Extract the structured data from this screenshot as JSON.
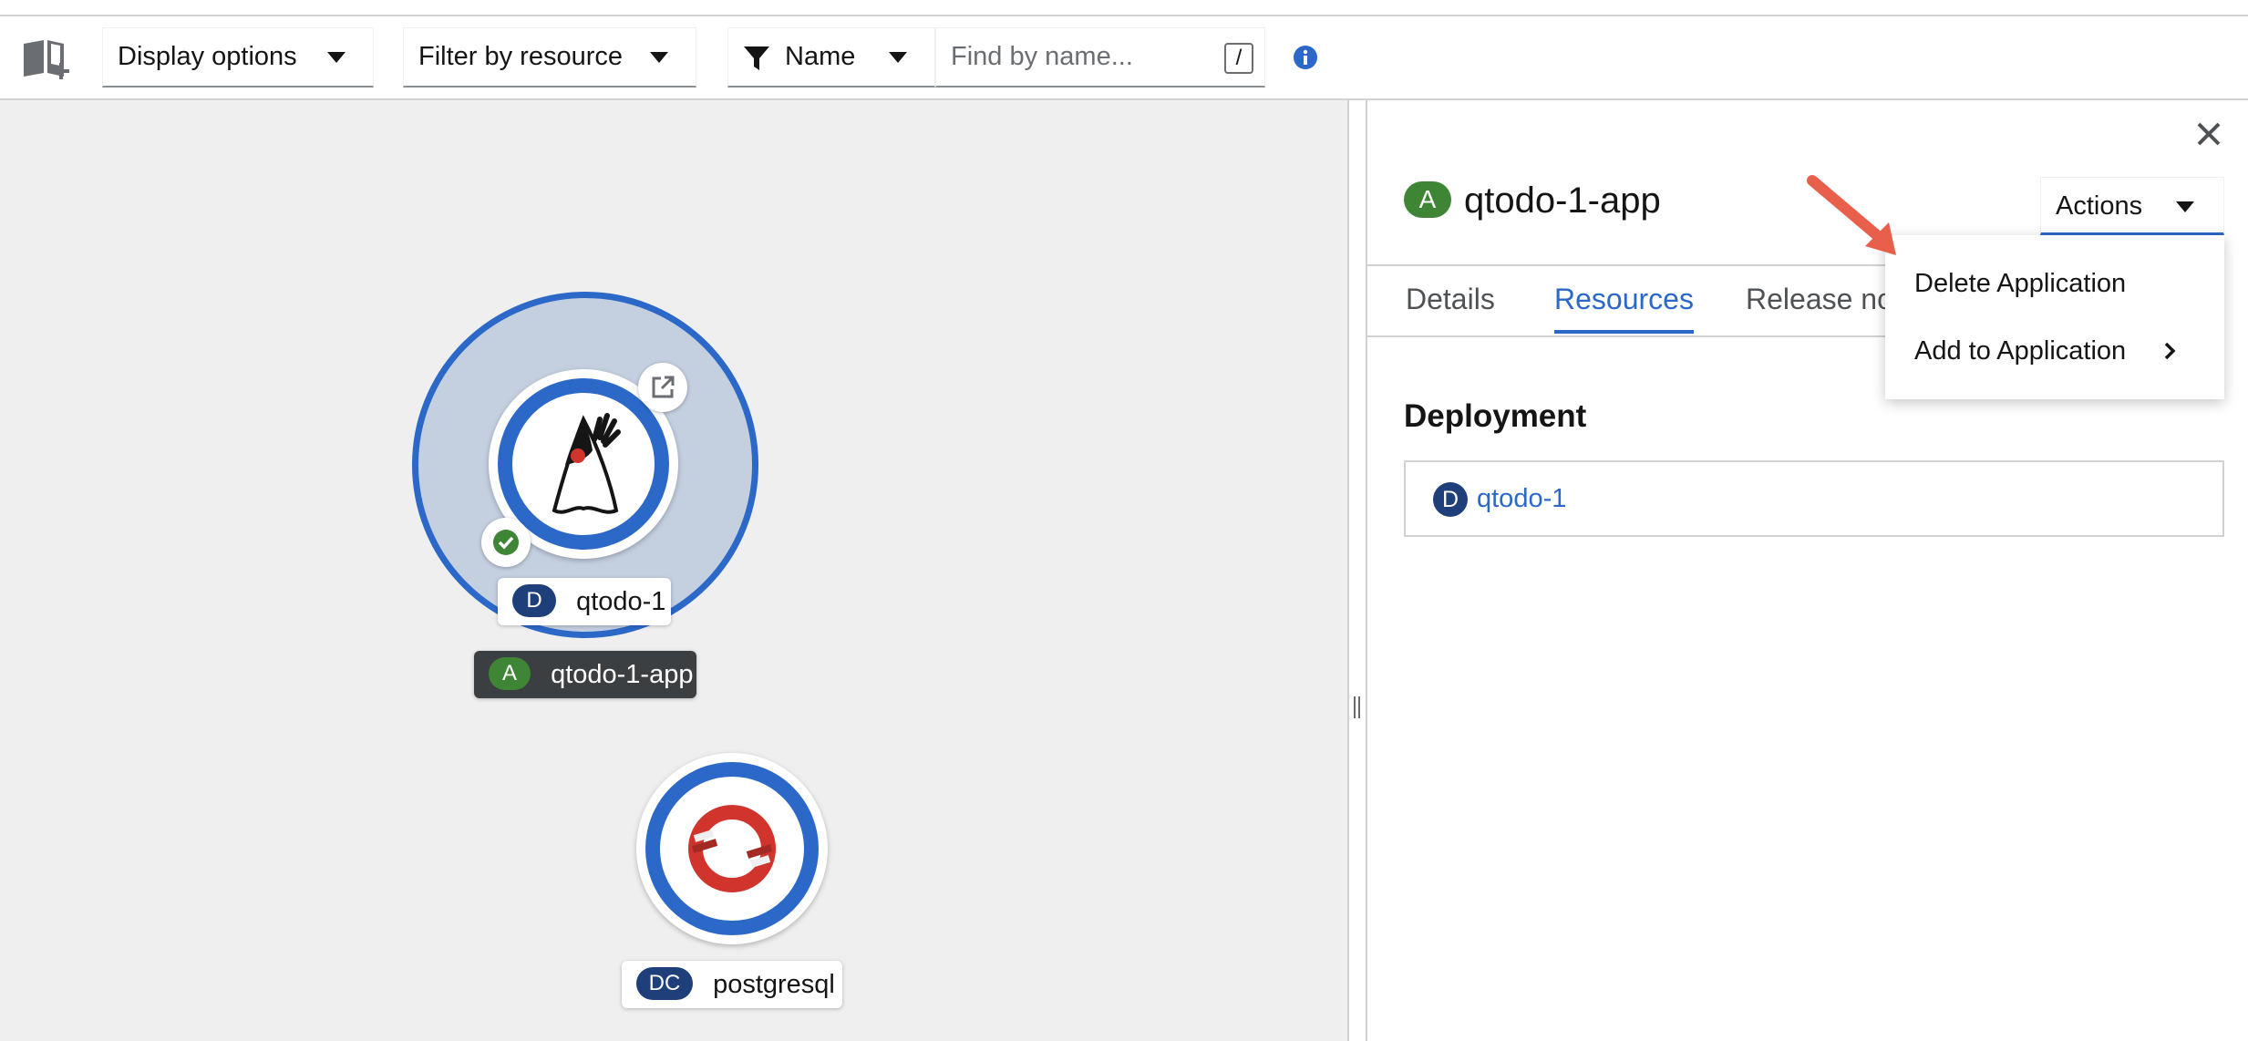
{
  "toolbar": {
    "display_options": "Display options",
    "filter_by_resource": "Filter by resource",
    "filter_type": "Name",
    "search_placeholder": "Find by name...",
    "search_shortcut": "/"
  },
  "topology": {
    "application_group": {
      "badge": "A",
      "name": "qtodo-1-app"
    },
    "nodes": [
      {
        "badge": "D",
        "name": "qtodo-1",
        "status": "ready"
      },
      {
        "badge": "DC",
        "name": "postgresql"
      }
    ]
  },
  "panel": {
    "title_badge": "A",
    "title": "qtodo-1-app",
    "actions_label": "Actions",
    "tabs": [
      {
        "label": "Details",
        "active": false
      },
      {
        "label": "Resources",
        "active": true
      },
      {
        "label": "Release notes",
        "active": false
      }
    ],
    "section_title": "Deployment",
    "resources": [
      {
        "badge": "D",
        "name": "qtodo-1"
      }
    ]
  },
  "actions_menu": {
    "items": [
      {
        "label": "Delete Application"
      },
      {
        "label": "Add to Application",
        "has_submenu": true
      }
    ]
  },
  "colors": {
    "accent_blue": "#2b68c8",
    "application_green": "#3e8635",
    "deployment_navy": "#1e3f7a",
    "annotation_arrow": "#e8604c"
  }
}
